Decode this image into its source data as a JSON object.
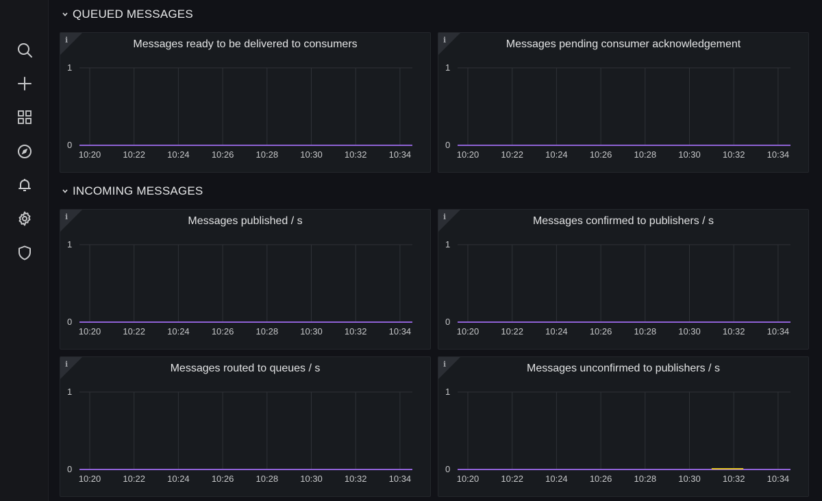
{
  "sidebar": {
    "items": [
      {
        "name": "search",
        "icon": "search-icon"
      },
      {
        "name": "create",
        "icon": "plus-icon"
      },
      {
        "name": "dashboards",
        "icon": "grid-icon"
      },
      {
        "name": "explore",
        "icon": "compass-icon"
      },
      {
        "name": "alerting",
        "icon": "bell-icon"
      },
      {
        "name": "configuration",
        "icon": "gear-icon"
      },
      {
        "name": "server-admin",
        "icon": "shield-icon"
      }
    ]
  },
  "rows": [
    {
      "title": "QUEUED MESSAGES"
    },
    {
      "title": "INCOMING MESSAGES"
    }
  ],
  "colors": {
    "series_line": "#8f62d6",
    "series_highlight": "#e0c323",
    "grid": "#2f3237",
    "background": "#111217",
    "panel": "#181b1f"
  },
  "chart_data": [
    {
      "type": "line",
      "title": "Messages ready to be delivered to consumers",
      "x": [
        "10:20",
        "10:22",
        "10:24",
        "10:26",
        "10:28",
        "10:30",
        "10:32",
        "10:34"
      ],
      "yticks": [
        "0",
        "1"
      ],
      "ylim": [
        0,
        1
      ],
      "series": [
        {
          "values": [
            0,
            0,
            0,
            0,
            0,
            0,
            0,
            0
          ]
        }
      ]
    },
    {
      "type": "line",
      "title": "Messages pending consumer acknowledgement",
      "x": [
        "10:20",
        "10:22",
        "10:24",
        "10:26",
        "10:28",
        "10:30",
        "10:32",
        "10:34"
      ],
      "yticks": [
        "0",
        "1"
      ],
      "ylim": [
        0,
        1
      ],
      "series": [
        {
          "values": [
            0,
            0,
            0,
            0,
            0,
            0,
            0,
            0
          ]
        }
      ]
    },
    {
      "type": "line",
      "title": "Messages published / s",
      "x": [
        "10:20",
        "10:22",
        "10:24",
        "10:26",
        "10:28",
        "10:30",
        "10:32",
        "10:34"
      ],
      "yticks": [
        "0",
        "1"
      ],
      "ylim": [
        0,
        1
      ],
      "series": [
        {
          "values": [
            0,
            0,
            0,
            0,
            0,
            0,
            0,
            0
          ]
        }
      ]
    },
    {
      "type": "line",
      "title": "Messages confirmed to publishers / s",
      "x": [
        "10:20",
        "10:22",
        "10:24",
        "10:26",
        "10:28",
        "10:30",
        "10:32",
        "10:34"
      ],
      "yticks": [
        "0",
        "1"
      ],
      "ylim": [
        0,
        1
      ],
      "series": [
        {
          "values": [
            0,
            0,
            0,
            0,
            0,
            0,
            0,
            0
          ]
        }
      ]
    },
    {
      "type": "line",
      "title": "Messages routed to queues / s",
      "x": [
        "10:20",
        "10:22",
        "10:24",
        "10:26",
        "10:28",
        "10:30",
        "10:32",
        "10:34"
      ],
      "yticks": [
        "0",
        "1"
      ],
      "ylim": [
        0,
        1
      ],
      "series": [
        {
          "values": [
            0,
            0,
            0,
            0,
            0,
            0,
            0,
            0
          ]
        }
      ]
    },
    {
      "type": "line",
      "title": "Messages unconfirmed to publishers / s",
      "x": [
        "10:20",
        "10:22",
        "10:24",
        "10:26",
        "10:28",
        "10:30",
        "10:32",
        "10:34"
      ],
      "yticks": [
        "0",
        "1"
      ],
      "ylim": [
        0,
        1
      ],
      "series": [
        {
          "values": [
            0,
            0,
            0,
            0,
            0,
            0,
            0,
            0
          ]
        }
      ],
      "highlight_x_range": [
        "10:31",
        "10:32"
      ]
    }
  ]
}
